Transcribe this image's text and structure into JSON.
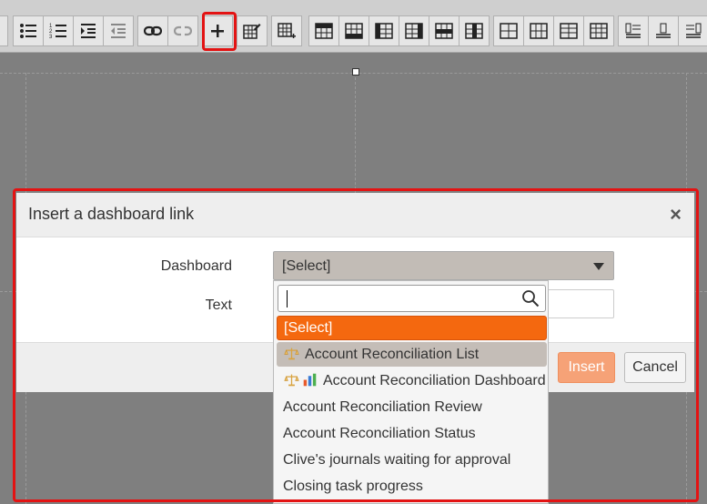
{
  "toolbar": {
    "buttons": [
      "bulleted-list",
      "numbered-list",
      "increase-indent",
      "decrease-indent",
      "link",
      "unlink",
      "add-dashboard-link",
      "edit-table",
      "insert-table",
      "insert-row-above",
      "insert-row-below",
      "insert-column-left",
      "insert-column-right",
      "delete-row",
      "delete-column",
      "merge-cells",
      "split-cells",
      "cell-properties",
      "table-properties",
      "align-left",
      "align-center",
      "align-right"
    ]
  },
  "dialog": {
    "title": "Insert a dashboard link",
    "close": "×",
    "dashboard_label": "Dashboard",
    "dashboard_value": "[Select]",
    "text_label": "Text",
    "insert_label": "Insert",
    "cancel_label": "Cancel"
  },
  "dropdown": {
    "search_placeholder": "",
    "options": [
      {
        "label": "[Select]",
        "state": "selected"
      },
      {
        "label": "Account Reconciliation List",
        "state": "hover",
        "icons": [
          "scales-icon"
        ]
      },
      {
        "label": "Account Reconciliation Dashboard",
        "state": "",
        "icons": [
          "scales-icon",
          "chart-icon"
        ]
      },
      {
        "label": "Account Reconciliation Review",
        "state": ""
      },
      {
        "label": "Account Reconciliation Status",
        "state": ""
      },
      {
        "label": "Clive's journals waiting for approval",
        "state": ""
      },
      {
        "label": "Closing task progress",
        "state": ""
      }
    ]
  },
  "colors": {
    "accent": "#f4680f",
    "highlight": "#e31313",
    "insert_button": "#f6a277"
  }
}
